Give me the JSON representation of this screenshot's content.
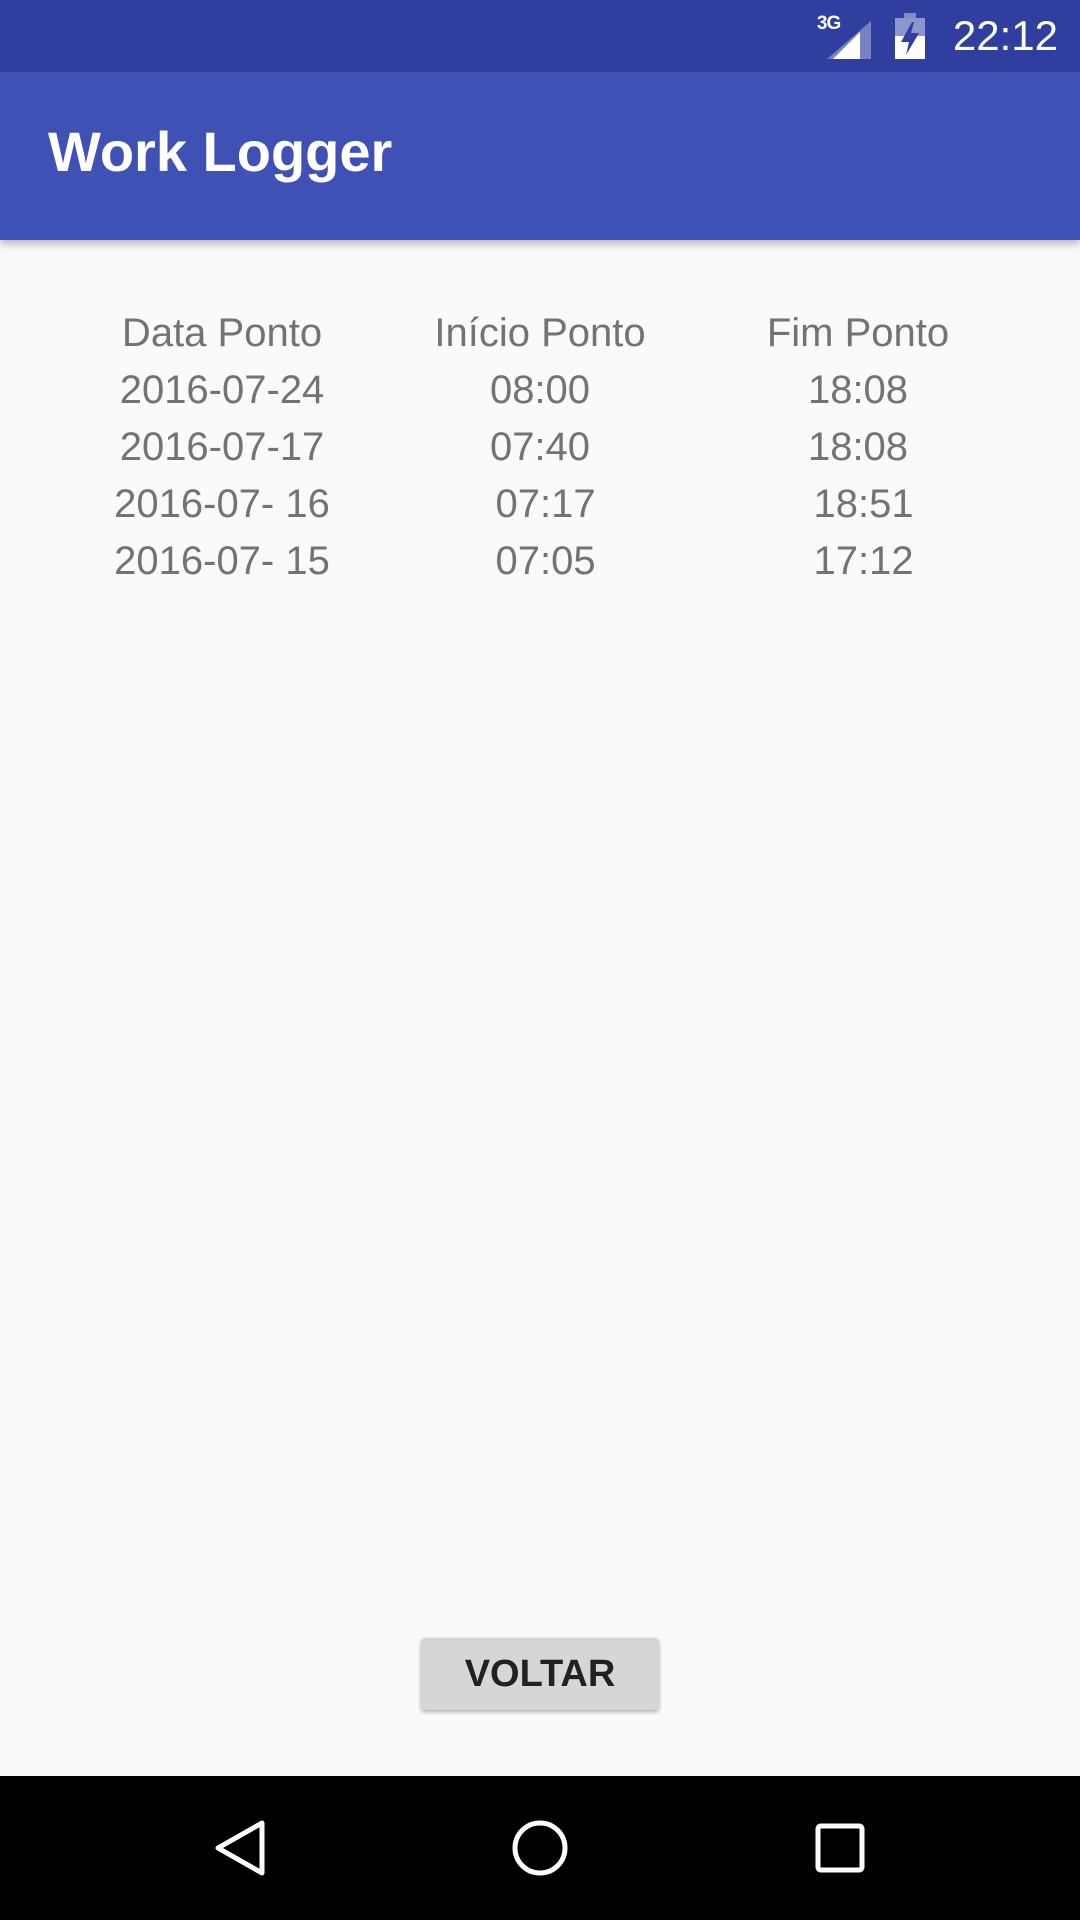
{
  "status_bar": {
    "network": "3G",
    "time": "22:12"
  },
  "app_bar": {
    "title": "Work Logger"
  },
  "table": {
    "headers": [
      "Data Ponto",
      "Início Ponto",
      "Fim Ponto"
    ],
    "rows": [
      [
        "2016-07-24",
        "08:00",
        "18:08"
      ],
      [
        "2016-07-17",
        "07:40",
        "18:08"
      ],
      [
        "2016-07- 16",
        " 07:17",
        " 18:51"
      ],
      [
        "2016-07- 15",
        " 07:05",
        " 17:12"
      ]
    ]
  },
  "back_button": {
    "label": "VOLTAR"
  },
  "nav_bar": {
    "icons": [
      "back-icon",
      "home-icon",
      "recents-icon"
    ]
  },
  "colors": {
    "status_bar": "#303f9f",
    "app_bar": "#3f51b5",
    "background": "#fafafa",
    "table_text": "#737373",
    "button_bg": "#d6d6d6",
    "nav_bar": "#000000"
  }
}
